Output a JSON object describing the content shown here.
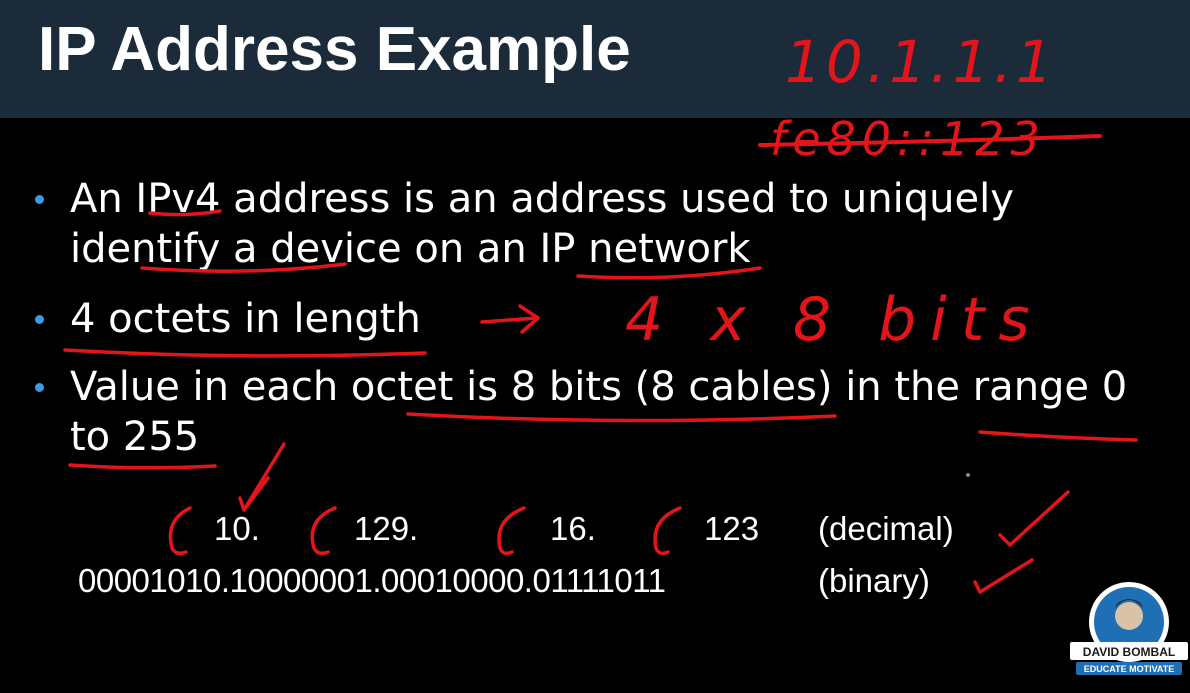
{
  "title": "IP Address Example",
  "bullets": [
    {
      "line1": "An IPv4 address is an address used to uniquely",
      "line2": "identify a device on an IP network"
    },
    {
      "line1": "4 octets in length",
      "line2": ""
    },
    {
      "line1": "Value in each octet is 8 bits (8 cables) in the range 0",
      "line2": "to 255"
    }
  ],
  "example": {
    "decimal_octets": [
      "10.",
      "129.",
      "16.",
      "123"
    ],
    "decimal_label": "(decimal)",
    "binary_value": "00001010.10000001.00010000.01111011",
    "binary_label": "(binary)"
  },
  "annotations": {
    "ipv4_example": "10.1.1.1",
    "ipv6_example_struck": "fe80::123",
    "octet_formula": "4 x 8 bits"
  },
  "logo": {
    "line1": "DAVID BOMBAL",
    "line2": "EDUCATE MOTIVATE"
  },
  "colors": {
    "title_bar": "#1c2b3a",
    "background": "#000000",
    "bullet": "#3d9be0",
    "ink": "#e4141b",
    "logo_blue": "#1f6fb5"
  }
}
